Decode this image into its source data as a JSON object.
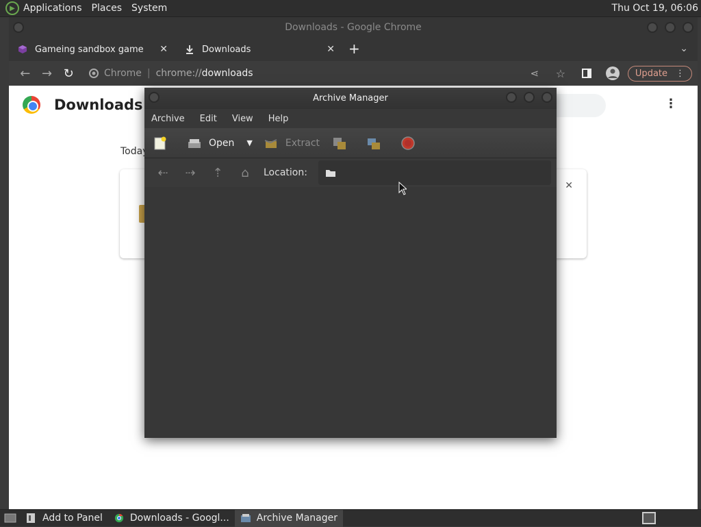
{
  "top_panel": {
    "menus": [
      "Applications",
      "Places",
      "System"
    ],
    "clock": "Thu Oct 19, 06:06"
  },
  "chrome": {
    "window_title": "Downloads - Google Chrome",
    "tabs": [
      {
        "label": "Gameing sandbox game",
        "icon": "cube-icon"
      },
      {
        "label": "Downloads",
        "icon": "download-icon"
      }
    ],
    "omnibox": {
      "scheme_label": "Chrome",
      "url_host": "chrome://",
      "url_path": "downloads"
    },
    "update_label": "Update",
    "page": {
      "title": "Downloads",
      "today_label": "Today"
    }
  },
  "archive_manager": {
    "title": "Archive Manager",
    "menus": [
      "Archive",
      "Edit",
      "View",
      "Help"
    ],
    "toolbar": {
      "open_label": "Open",
      "extract_label": "Extract"
    },
    "location_label": "Location:"
  },
  "bottom_panel": {
    "items": [
      "Add to Panel",
      "Downloads - Googl...",
      "Archive Manager"
    ]
  },
  "colors": {
    "accent_update": "#c68a7a",
    "panel_bg": "#2e2e2e",
    "stop_red": "#c0392b"
  }
}
